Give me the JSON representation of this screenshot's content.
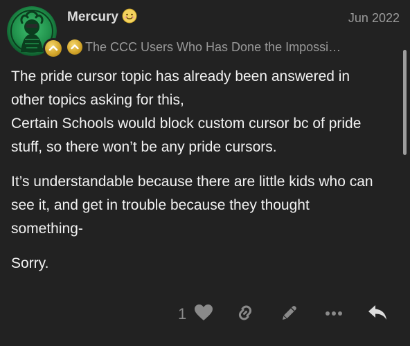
{
  "post": {
    "username": "Mercury",
    "date": "Jun 2022",
    "user_title": "The CCC Users Who Has Done the Impossi…",
    "paragraphs": [
      {
        "lines": [
          "The pride cursor topic has already been answered in",
          "other topics asking for this,",
          "Certain Schools would block custom cursor bc of pride",
          "stuff, so there won’t be any pride cursors."
        ]
      },
      {
        "lines": [
          "It’s understandable because there are little kids who can",
          "see it, and get in trouble because they thought",
          "something-"
        ]
      },
      {
        "lines": [
          "Sorry."
        ]
      }
    ]
  },
  "actions": {
    "like_count": "1"
  },
  "icons": {
    "avatar": "avatar-image",
    "emoji": "smiling-face-emoji",
    "flair": "flair-chevron-icon",
    "title_badge": "chevron-up-badge-icon",
    "like": "heart-icon",
    "link": "link-icon",
    "edit": "pencil-icon",
    "more": "more-horizontal-icon",
    "reply": "reply-arrow-icon"
  },
  "colors": {
    "background": "#222222",
    "text": "#f2f2f2",
    "muted": "#9a9a9a",
    "badge_gold": "#d4a72c",
    "avatar_green": "#1f8f4a"
  }
}
